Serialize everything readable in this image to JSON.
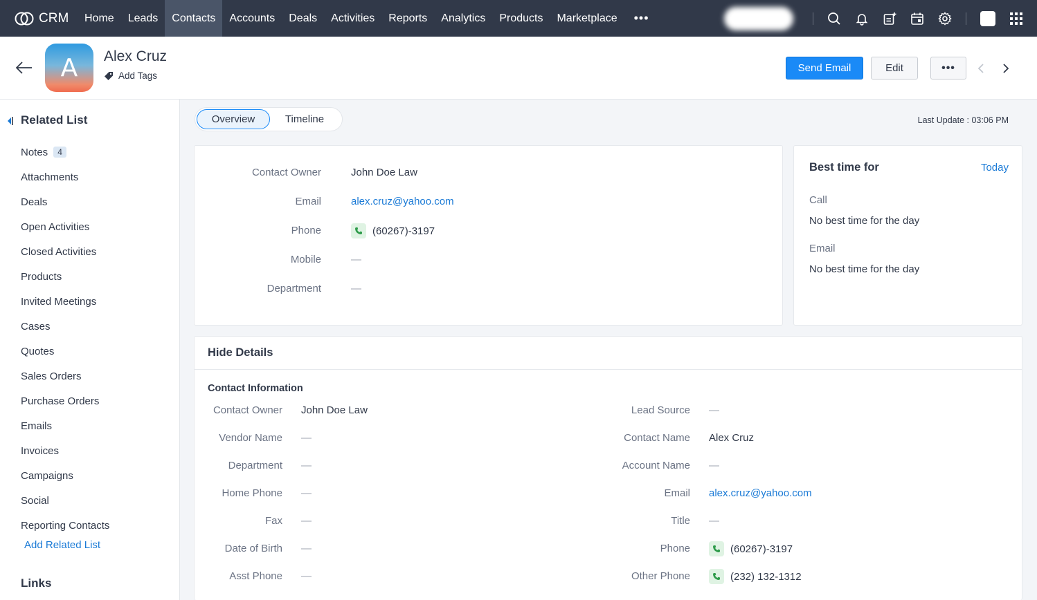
{
  "app": {
    "brand": "CRM"
  },
  "nav": {
    "tabs": [
      "Home",
      "Leads",
      "Contacts",
      "Accounts",
      "Deals",
      "Activities",
      "Reports",
      "Analytics",
      "Products",
      "Marketplace"
    ],
    "active_tab": "Contacts",
    "more": "•••"
  },
  "record": {
    "avatar_letter": "A",
    "name": "Alex Cruz",
    "add_tags": "Add Tags",
    "send_email": "Send Email",
    "edit": "Edit",
    "more": "•••"
  },
  "related_list": {
    "title": "Related List",
    "items": [
      {
        "label": "Notes",
        "badge": "4"
      },
      {
        "label": "Attachments"
      },
      {
        "label": "Deals"
      },
      {
        "label": "Open Activities"
      },
      {
        "label": "Closed Activities"
      },
      {
        "label": "Products"
      },
      {
        "label": "Invited Meetings"
      },
      {
        "label": "Cases"
      },
      {
        "label": "Quotes"
      },
      {
        "label": "Sales Orders"
      },
      {
        "label": "Purchase Orders"
      },
      {
        "label": "Emails"
      },
      {
        "label": "Invoices"
      },
      {
        "label": "Campaigns"
      },
      {
        "label": "Social"
      },
      {
        "label": "Reporting Contacts"
      }
    ],
    "add_related": "Add Related List",
    "links_title": "Links"
  },
  "view_toggle": {
    "overview": "Overview",
    "timeline": "Timeline"
  },
  "last_update": "Last Update : 03:06 PM",
  "overview": {
    "contact_owner_label": "Contact Owner",
    "contact_owner": "John Doe Law",
    "email_label": "Email",
    "email": "alex.cruz@yahoo.com",
    "phone_label": "Phone",
    "phone": "(60267)-3197",
    "mobile_label": "Mobile",
    "mobile": "—",
    "department_label": "Department",
    "department": "—"
  },
  "best_time": {
    "title": "Best time for",
    "today": "Today",
    "call_label": "Call",
    "call_value": "No best time for the day",
    "email_label": "Email",
    "email_value": "No best time for the day"
  },
  "details": {
    "toggle": "Hide Details",
    "section": "Contact Information",
    "left": [
      {
        "label": "Contact Owner",
        "value": "John Doe Law"
      },
      {
        "label": "Vendor Name",
        "value": "—"
      },
      {
        "label": "Department",
        "value": "—"
      },
      {
        "label": "Home Phone",
        "value": "—"
      },
      {
        "label": "Fax",
        "value": "—"
      },
      {
        "label": "Date of Birth",
        "value": "—"
      },
      {
        "label": "Asst Phone",
        "value": "—"
      }
    ],
    "right": [
      {
        "label": "Lead Source",
        "value": "—"
      },
      {
        "label": "Contact Name",
        "value": "Alex Cruz"
      },
      {
        "label": "Account Name",
        "value": "—"
      },
      {
        "label": "Email",
        "value": "alex.cruz@yahoo.com"
      },
      {
        "label": "Title",
        "value": "—"
      },
      {
        "label": "Phone",
        "value": "(60267)-3197"
      },
      {
        "label": "Other Phone",
        "value": "(232) 132-1312"
      }
    ]
  },
  "colors": {
    "nav_bg": "#313949",
    "accent": "#1a8af7",
    "link": "#1a7ad6"
  }
}
